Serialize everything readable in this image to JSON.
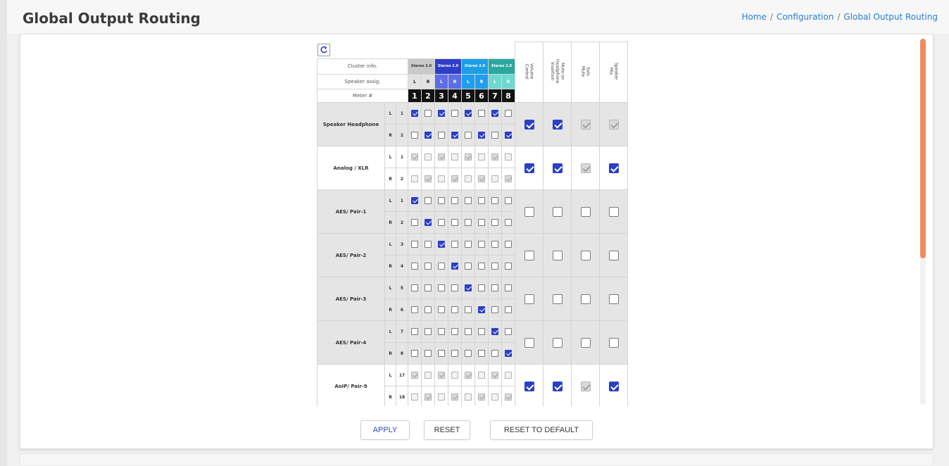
{
  "header": {
    "title": "Global Output Routing",
    "breadcrumb": [
      "Home",
      "/",
      "Configuration",
      "/",
      "Global Output Routing"
    ]
  },
  "table": {
    "row_headers": [
      "Cluster info.",
      "Speaker assig.",
      "Meter #"
    ],
    "clusters": [
      "Stereo 2.0",
      "Stereo 2.0",
      "Stereo 2.0",
      "Stereo 2.0"
    ],
    "speaker_assign": [
      "L",
      "R",
      "L",
      "R",
      "L",
      "R",
      "L",
      "R"
    ],
    "meters": [
      "1",
      "2",
      "3",
      "4",
      "5",
      "6",
      "7",
      "8"
    ],
    "right_headers": [
      "Volume\nControl",
      "Mute on\nHeadphone\nInsertion",
      "Solo\nMute",
      "Speaker\nMix"
    ],
    "groups": [
      {
        "name": "Speaker Headphone",
        "shade": "grey",
        "rows": [
          {
            "lr": "L",
            "ch": "1",
            "checks": [
              1,
              0,
              1,
              0,
              1,
              0,
              1,
              0
            ]
          },
          {
            "lr": "R",
            "ch": "2",
            "checks": [
              0,
              1,
              0,
              1,
              0,
              1,
              0,
              1
            ]
          }
        ],
        "disabled": [
          0,
          0,
          0,
          0,
          0,
          0,
          0,
          0
        ],
        "opts": [
          1,
          1,
          1,
          1
        ],
        "opts_disabled": [
          0,
          0,
          1,
          1
        ]
      },
      {
        "name": "Analog / XLR",
        "shade": "white",
        "rows": [
          {
            "lr": "L",
            "ch": "1",
            "checks": [
              1,
              0,
              1,
              0,
              1,
              0,
              1,
              0
            ]
          },
          {
            "lr": "R",
            "ch": "2",
            "checks": [
              0,
              1,
              0,
              1,
              0,
              1,
              0,
              1
            ]
          }
        ],
        "disabled": [
          1,
          1,
          1,
          1,
          1,
          1,
          1,
          1
        ],
        "opts": [
          1,
          1,
          1,
          1
        ],
        "opts_disabled": [
          0,
          0,
          1,
          0
        ]
      },
      {
        "name": "AES/ Pair-1",
        "shade": "grey",
        "rows": [
          {
            "lr": "L",
            "ch": "1",
            "checks": [
              1,
              0,
              0,
              0,
              0,
              0,
              0,
              0
            ]
          },
          {
            "lr": "R",
            "ch": "2",
            "checks": [
              0,
              1,
              0,
              0,
              0,
              0,
              0,
              0
            ]
          }
        ],
        "disabled": [
          0,
          0,
          0,
          0,
          0,
          0,
          0,
          0
        ],
        "opts": [
          0,
          0,
          0,
          0
        ],
        "opts_disabled": [
          0,
          0,
          0,
          0
        ]
      },
      {
        "name": "AES/ Pair-2",
        "shade": "grey",
        "rows": [
          {
            "lr": "L",
            "ch": "3",
            "checks": [
              0,
              0,
              1,
              0,
              0,
              0,
              0,
              0
            ]
          },
          {
            "lr": "R",
            "ch": "4",
            "checks": [
              0,
              0,
              0,
              1,
              0,
              0,
              0,
              0
            ]
          }
        ],
        "disabled": [
          0,
          0,
          0,
          0,
          0,
          0,
          0,
          0
        ],
        "opts": [
          0,
          0,
          0,
          0
        ],
        "opts_disabled": [
          0,
          0,
          0,
          0
        ]
      },
      {
        "name": "AES/ Pair-3",
        "shade": "grey",
        "rows": [
          {
            "lr": "L",
            "ch": "5",
            "checks": [
              0,
              0,
              0,
              0,
              1,
              0,
              0,
              0
            ]
          },
          {
            "lr": "R",
            "ch": "6",
            "checks": [
              0,
              0,
              0,
              0,
              0,
              1,
              0,
              0
            ]
          }
        ],
        "disabled": [
          0,
          0,
          0,
          0,
          0,
          0,
          0,
          0
        ],
        "opts": [
          0,
          0,
          0,
          0
        ],
        "opts_disabled": [
          0,
          0,
          0,
          0
        ]
      },
      {
        "name": "AES/ Pair-4",
        "shade": "grey",
        "rows": [
          {
            "lr": "L",
            "ch": "7",
            "checks": [
              0,
              0,
              0,
              0,
              0,
              0,
              1,
              0
            ]
          },
          {
            "lr": "R",
            "ch": "8",
            "checks": [
              0,
              0,
              0,
              0,
              0,
              0,
              0,
              1
            ]
          }
        ],
        "disabled": [
          0,
          0,
          0,
          0,
          0,
          0,
          0,
          0
        ],
        "opts": [
          0,
          0,
          0,
          0
        ],
        "opts_disabled": [
          0,
          0,
          0,
          0
        ]
      },
      {
        "name": "AoIP/ Pair-9",
        "shade": "white",
        "rows": [
          {
            "lr": "L",
            "ch": "17",
            "checks": [
              1,
              0,
              1,
              0,
              1,
              0,
              1,
              0
            ]
          },
          {
            "lr": "R",
            "ch": "18",
            "checks": [
              0,
              1,
              0,
              1,
              0,
              1,
              0,
              1
            ]
          }
        ],
        "disabled": [
          1,
          1,
          1,
          1,
          1,
          1,
          1,
          1
        ],
        "opts": [
          1,
          1,
          1,
          1
        ],
        "opts_disabled": [
          0,
          0,
          1,
          0
        ]
      }
    ]
  },
  "buttons": {
    "apply": "APPLY",
    "reset": "RESET",
    "reset_default": "RESET TO DEFAULT"
  },
  "scroll": {
    "position_fraction": 0.0,
    "visible_fraction": 0.6
  },
  "colors": {
    "accent": "#2b3fc8",
    "link": "#2a7ed1",
    "scroll_thumb": "#f08c5f"
  }
}
